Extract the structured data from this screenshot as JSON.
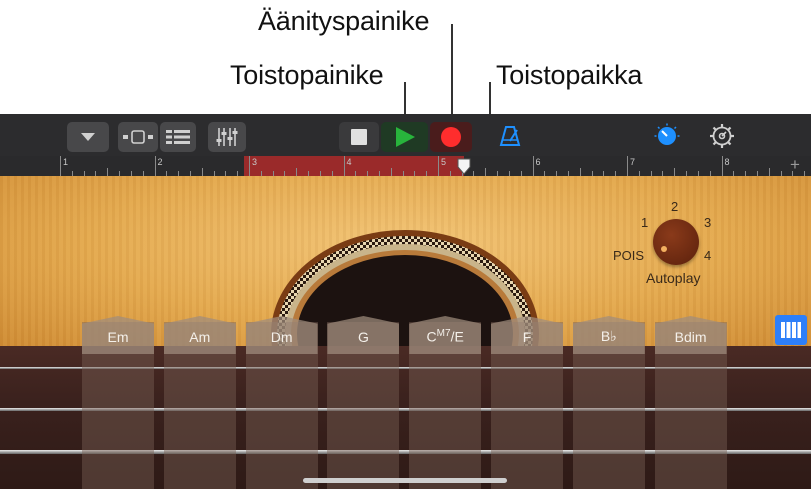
{
  "callouts": {
    "record_button": "Äänityspainike",
    "play_button": "Toistopainike",
    "playhead": "Toistopaikka"
  },
  "toolbar": {
    "icons": [
      "chevron-down-icon",
      "browser-icon",
      "tracks-icon",
      "mixer-icon",
      "stop-icon",
      "play-icon",
      "record-icon",
      "metronome-icon",
      "master-volume-icon",
      "settings-icon"
    ],
    "colors": {
      "play": "#28b43c",
      "record": "#ff2d2d",
      "accent": "#1e90ff"
    }
  },
  "ruler": {
    "bars": [
      "1",
      "2",
      "3",
      "4",
      "5",
      "6",
      "7",
      "8"
    ],
    "add_label": "+",
    "cycle_color": "#9a2a2a"
  },
  "autoplay": {
    "label": "Autoplay",
    "off_label": "POIS",
    "positions": [
      "1",
      "2",
      "3",
      "4"
    ],
    "selected": "POIS"
  },
  "chords": [
    {
      "name": "Em",
      "sup": ""
    },
    {
      "name": "Am",
      "sup": ""
    },
    {
      "name": "Dm",
      "sup": ""
    },
    {
      "name": "G",
      "sup": ""
    },
    {
      "name": "C",
      "sup": "M7",
      "suffix": "/E"
    },
    {
      "name": "F",
      "sup": ""
    },
    {
      "name": "B♭",
      "sup": ""
    },
    {
      "name": "Bdim",
      "sup": ""
    }
  ],
  "strings_view_icon": "strings-view-icon"
}
